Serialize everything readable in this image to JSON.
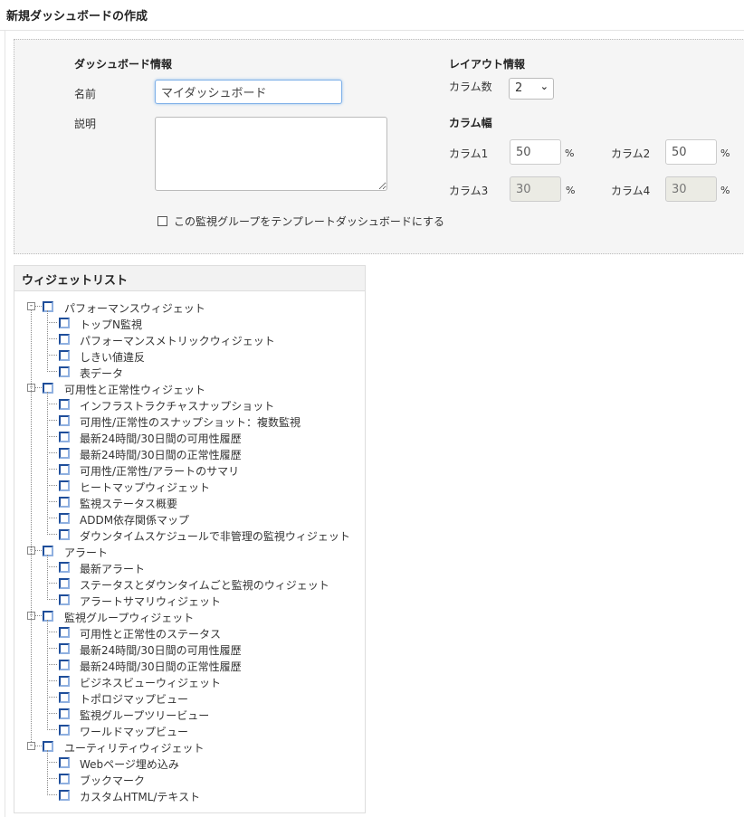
{
  "title": "新規ダッシュボードの作成",
  "dashboard_info": {
    "heading": "ダッシュボード情報",
    "name_label": "名前",
    "name_value": "マイダッシュボード",
    "description_label": "説明",
    "description_value": "",
    "template_checkbox_label": "この監視グループをテンプレートダッシュボードにする",
    "template_checked": false
  },
  "layout_info": {
    "heading": "レイアウト情報",
    "columns_label": "カラム数",
    "columns_value": "2",
    "width_heading": "カラム幅",
    "columns": [
      {
        "label": "カラム1",
        "value": "50",
        "unit": "%",
        "enabled": true
      },
      {
        "label": "カラム2",
        "value": "50",
        "unit": "%",
        "enabled": true
      },
      {
        "label": "カラム3",
        "value": "30",
        "unit": "%",
        "enabled": false
      },
      {
        "label": "カラム4",
        "value": "30",
        "unit": "%",
        "enabled": false
      }
    ]
  },
  "widget_list": {
    "heading": "ウィジェットリスト",
    "groups": [
      {
        "label": "パフォーマンスウィジェット",
        "items": [
          "トップN監視",
          "パフォーマンスメトリックウィジェット",
          "しきい値違反",
          "表データ"
        ]
      },
      {
        "label": "可用性と正常性ウィジェット",
        "items": [
          "インフラストラクチャスナップショット",
          "可用性/正常性のスナップショット：複数監視",
          "最新24時間/30日間の可用性履歴",
          "最新24時間/30日間の正常性履歴",
          "可用性/正常性/アラートのサマリ",
          "ヒートマップウィジェット",
          "監視ステータス概要",
          "ADDM依存関係マップ",
          "ダウンタイムスケジュールで非管理の監視ウィジェット"
        ]
      },
      {
        "label": "アラート",
        "items": [
          "最新アラート",
          "ステータスとダウンタイムごと監視のウィジェット",
          "アラートサマリウィジェット"
        ]
      },
      {
        "label": "監視グループウィジェット",
        "items": [
          "可用性と正常性のステータス",
          "最新24時間/30日間の可用性履歴",
          "最新24時間/30日間の正常性履歴",
          "ビジネスビューウィジェット",
          "トポロジマップビュー",
          "監視グループツリービュー",
          "ワールドマップビュー"
        ]
      },
      {
        "label": "ユーティリティウィジェット",
        "items": [
          "Webページ埋め込み",
          "ブックマーク",
          "カスタムHTML/テキスト"
        ]
      }
    ]
  }
}
